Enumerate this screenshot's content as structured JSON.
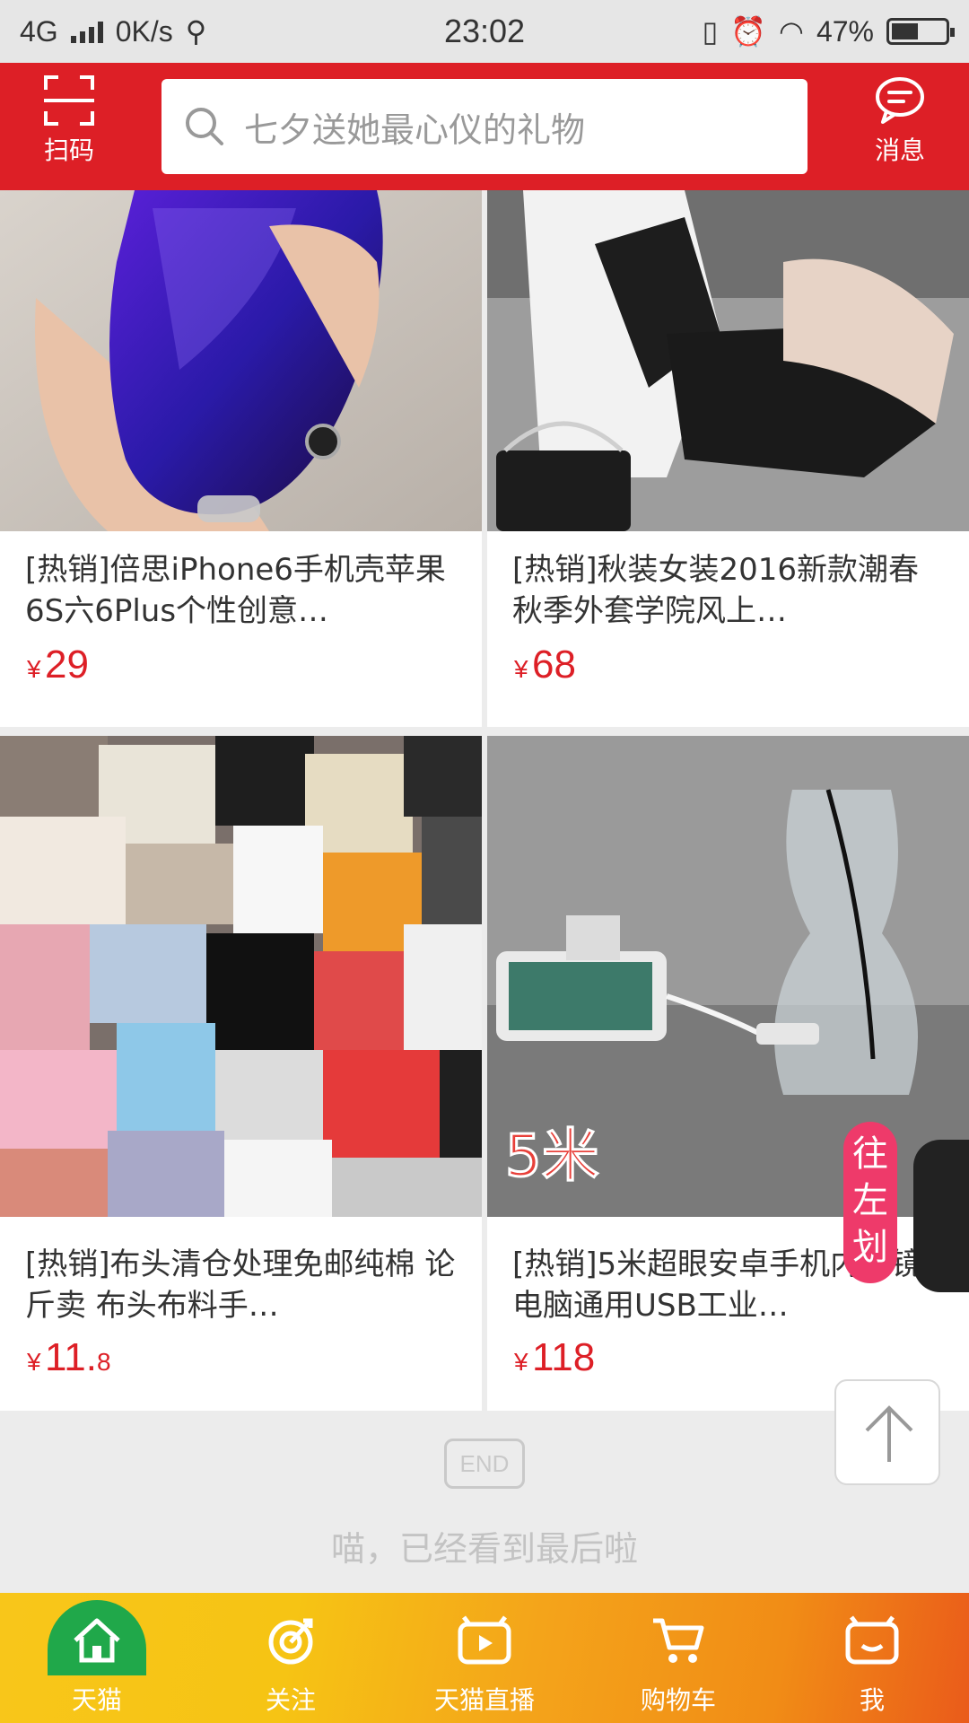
{
  "status_bar": {
    "network": "4G",
    "speed": "0K/s",
    "time": "23:02",
    "battery": "47%"
  },
  "header": {
    "scan_label": "扫码",
    "search_placeholder": "七夕送她最心仪的礼物",
    "message_label": "消息"
  },
  "products": [
    {
      "title": "[热销]倍思iPhone6手机壳苹果6S六6Plus个性创意…",
      "currency": "¥",
      "price": "29",
      "price_decimal": ""
    },
    {
      "title": "[热销]秋装女装2016新款潮春秋季外套学院风上…",
      "currency": "¥",
      "price": "68",
      "price_decimal": ""
    },
    {
      "title": "[热销]布头清仓处理免邮纯棉 论斤卖 布头布料手…",
      "currency": "¥",
      "price": "11.",
      "price_decimal": "8"
    },
    {
      "title": "[热销]5米超眼安卓手机内窥镜电脑通用USB工业…",
      "currency": "¥",
      "price": "118",
      "price_decimal": "",
      "image_overlay_text": "5米"
    }
  ],
  "end": {
    "badge": "END",
    "text": "喵，已经看到最后啦"
  },
  "float_ad": {
    "text": "往左划"
  },
  "tabbar": {
    "tabs": [
      {
        "label": "天猫",
        "icon": "home-icon",
        "active": true
      },
      {
        "label": "关注",
        "icon": "follow-icon",
        "active": false
      },
      {
        "label": "天猫直播",
        "icon": "live-icon",
        "active": false
      },
      {
        "label": "购物车",
        "icon": "cart-icon",
        "active": false
      },
      {
        "label": "我",
        "icon": "profile-icon",
        "active": false
      }
    ]
  },
  "colors": {
    "brand_red": "#dd1f26",
    "price_red": "#dd1f26",
    "tab_yellow": "#f6c414",
    "tab_orange": "#f18c16",
    "home_green": "#20a84a"
  }
}
